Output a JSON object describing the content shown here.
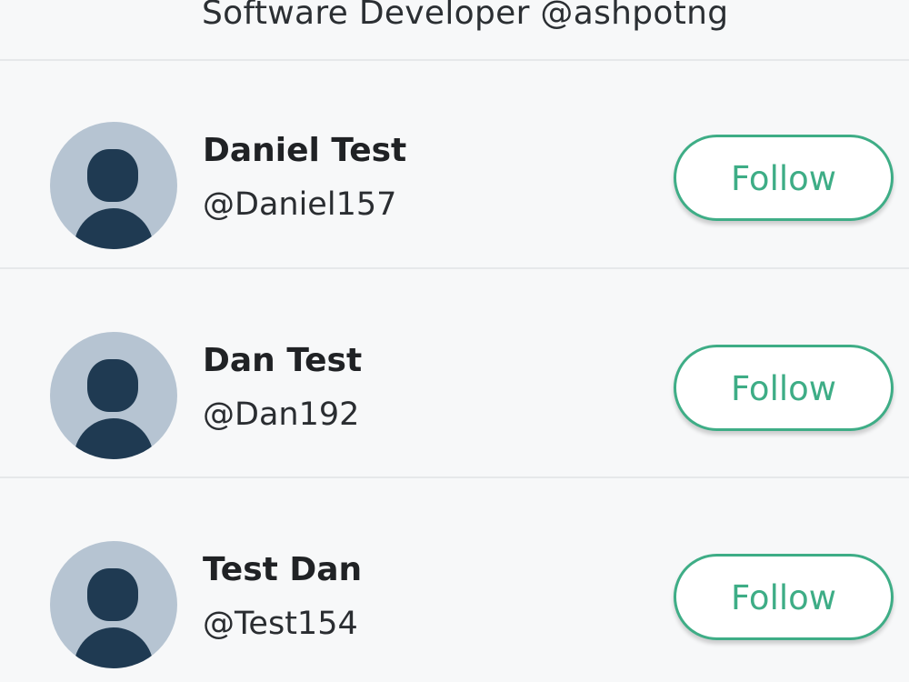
{
  "header": {
    "bio": "Software Developer @ashpotng"
  },
  "users": [
    {
      "name": "Daniel Test",
      "handle": "@Daniel157",
      "follow_label": "Follow",
      "avatar_icon": "user-silhouette-icon"
    },
    {
      "name": "Dan Test",
      "handle": "@Dan192",
      "follow_label": "Follow",
      "avatar_icon": "user-silhouette-icon"
    },
    {
      "name": "Test Dan",
      "handle": "@Test154",
      "follow_label": "Follow",
      "avatar_icon": "user-silhouette-icon"
    }
  ],
  "colors": {
    "accent": "#3ead86",
    "avatar_bg": "#b6c4d2",
    "avatar_figure": "#1f3a52",
    "background": "#f7f8f9",
    "divider": "#e6e8ea"
  }
}
